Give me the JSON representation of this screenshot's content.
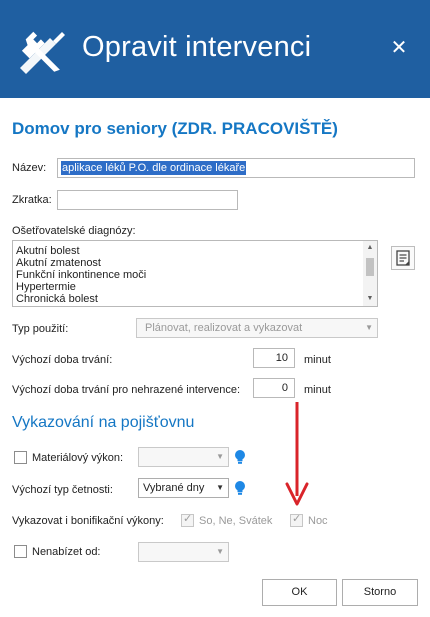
{
  "dialog": {
    "title": "Opravit intervenci",
    "close_label": "✕",
    "header_color": "#1f5fa1"
  },
  "section": {
    "title": "Domov pro seniory (ZDR. PRACOVIŠTĚ)"
  },
  "form": {
    "nazev_label": "Název:",
    "nazev_value": "aplikace léků P.O. dle ordinace lékaře",
    "zkratka_label": "Zkratka:",
    "zkratka_value": "",
    "diagnozy_label": "Ošetřovatelské diagnózy:",
    "diagnozy_items": [
      "Akutní bolest",
      "Akutní zmatenost",
      "Funkční inkontinence moči",
      "Hypertermie",
      "Chronická bolest"
    ],
    "typ_pouziti_label": "Typ použití:",
    "typ_pouziti_value": "Plánovat, realizovat a vykazovat",
    "doba_label": "Výchozí doba trvání:",
    "doba_value": "10",
    "doba_unit": "minut",
    "doba_nehrazene_label": "Výchozí doba trvání pro nehrazené intervence:",
    "doba_nehrazene_value": "0",
    "doba_nehrazene_unit": "minut"
  },
  "vykazovani": {
    "heading": "Vykazování na pojišťovnu",
    "materialovy_label": "Materiálový výkon:",
    "materialovy_checked": false,
    "materialovy_value": "",
    "cetnost_label": "Výchozí typ četnosti:",
    "cetnost_value": "Vybrané dny",
    "bonifikacni_label": "Vykazovat i bonifikační výkony:",
    "bonif_option1": "So, Ne, Svátek",
    "bonif_option2": "Noc",
    "nenabizet_label": "Nenabízet od:",
    "nenabizet_checked": false,
    "nenabizet_value": ""
  },
  "buttons": {
    "ok": "OK",
    "cancel": "Storno"
  },
  "colors": {
    "accent": "#1577c4",
    "annotation_arrow": "#d9242a",
    "bulb": "#1e88e5"
  }
}
